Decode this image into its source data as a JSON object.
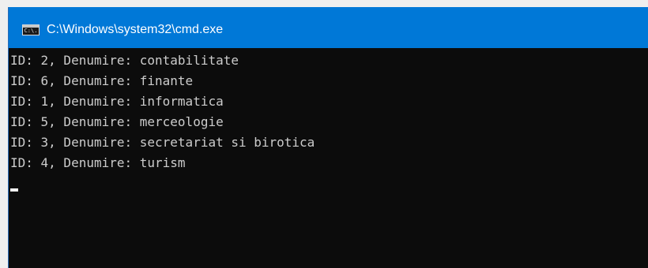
{
  "window": {
    "title": "C:\\Windows\\system32\\cmd.exe",
    "icon": "cmd-icon",
    "icon_text": "C:\\."
  },
  "console": {
    "lines": [
      "ID: 2, Denumire: contabilitate",
      "ID: 6, Denumire: finante",
      "ID: 1, Denumire: informatica",
      "ID: 5, Denumire: merceologie",
      "ID: 3, Denumire: secretariat si birotica",
      "ID: 4, Denumire: turism"
    ]
  },
  "colors": {
    "titlebar": "#0078d7",
    "console_bg": "#0c0c0c",
    "console_text": "#cccccc"
  }
}
